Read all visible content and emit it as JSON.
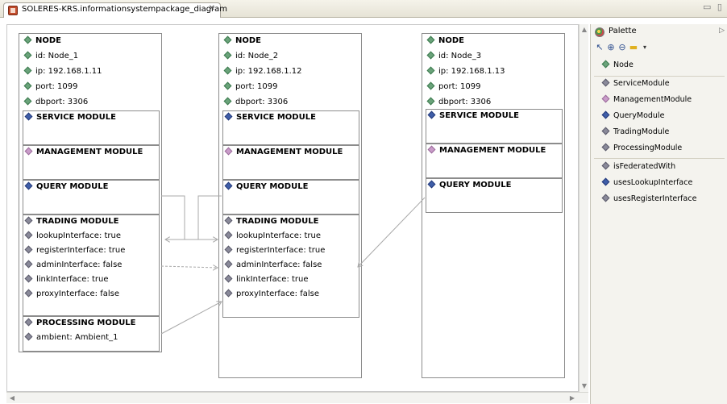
{
  "editor": {
    "tab_title": "SOLERES-KRS.informationsystempackage_diagram",
    "tab_close": "✕",
    "window_controls": "▭ ▯"
  },
  "nodes": [
    {
      "header": "NODE",
      "attributes": [
        "id: Node_1",
        "ip: 192.168.1.11",
        "port: 1099",
        "dbport: 3306"
      ],
      "service_module": "SERVICE MODULE",
      "management_module": "MANAGEMENT MODULE",
      "query_module": "QUERY MODULE",
      "trading_module": "TRADING MODULE",
      "trading_attributes": [
        "lookupInterface: true",
        "registerInterface: true",
        "adminInterface: false",
        "linkInterface: true",
        "proxyInterface: false"
      ],
      "processing_module": "PROCESSING MODULE",
      "processing_attributes": [
        "ambient: Ambient_1"
      ]
    },
    {
      "header": "NODE",
      "attributes": [
        "id: Node_2",
        "ip: 192.168.1.12",
        "port: 1099",
        "dbport: 3306"
      ],
      "service_module": "SERVICE MODULE",
      "management_module": "MANAGEMENT MODULE",
      "query_module": "QUERY MODULE",
      "trading_module": "TRADING MODULE",
      "trading_attributes": [
        "lookupInterface: true",
        "registerInterface: true",
        "adminInterface: false",
        "linkInterface: true",
        "proxyInterface: false"
      ]
    },
    {
      "header": "NODE",
      "attributes": [
        "id: Node_3",
        "ip: 192.168.1.13",
        "port: 1099",
        "dbport: 3306"
      ],
      "service_module": "SERVICE MODULE",
      "management_module": "MANAGEMENT MODULE",
      "query_module": "QUERY MODULE"
    }
  ],
  "palette": {
    "title": "Palette",
    "collapse_glyph": "▷",
    "tools": [
      "select-arrow-icon",
      "zoom-in-icon",
      "zoom-out-icon",
      "note-folder-icon",
      "dropdown-icon"
    ],
    "items": [
      {
        "label": "Node",
        "color": "green",
        "icon": "node-icon"
      },
      {
        "label": "ServiceModule",
        "color": "grey",
        "icon": "service-module-icon"
      },
      {
        "label": "ManagementModule",
        "color": "pink",
        "icon": "management-module-icon"
      },
      {
        "label": "QueryModule",
        "color": "blue",
        "icon": "query-module-icon"
      },
      {
        "label": "TradingModule",
        "color": "grey",
        "icon": "trading-module-icon"
      },
      {
        "label": "ProcessingModule",
        "color": "grey",
        "icon": "processing-module-icon"
      },
      {
        "label": "isFederatedWith",
        "color": "grey",
        "icon": "is-federated-with-icon"
      },
      {
        "label": "usesLookupInterface",
        "color": "blue",
        "icon": "uses-lookup-interface-icon"
      },
      {
        "label": "usesRegisterInterface",
        "color": "grey",
        "icon": "uses-register-interface-icon"
      }
    ]
  },
  "colors": {
    "node_border": "#8c8c8c",
    "attribute_diamond": "#6aa37a",
    "query_diamond": "#3f5ea8",
    "management_diamond": "#c99cc9",
    "connector": "#a9a9a9",
    "palette_bg": "#f4f3ee"
  }
}
